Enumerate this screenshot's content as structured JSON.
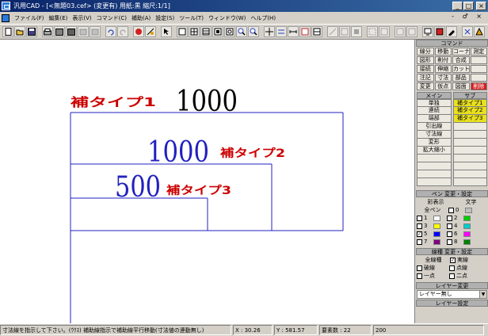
{
  "window": {
    "title": "汎用CAD - [<無題03.cef> (変更有) 用紙:黒 縮尺:1/1]",
    "controls": [
      "_",
      "□",
      "×"
    ],
    "mdi_controls": "- ♂ ×"
  },
  "menu": [
    "ファイル(F)",
    "編集(E)",
    "表示(V)",
    "コマンド(C)",
    "補助(A)",
    "設定(S)",
    "ツール(T)",
    "ウィンドウ(W)",
    "ヘルプ(H)"
  ],
  "toolbar": [
    "new",
    "open",
    "save",
    "print",
    "preview",
    "print2",
    "cut",
    "copy",
    "undo",
    "redo",
    "stop",
    "snap",
    "grid",
    "rect",
    "dim",
    "delete",
    "zoom-in",
    "zoom-out",
    "pan",
    "fit",
    "move",
    "line",
    "arc",
    "text",
    "layer",
    "ortho",
    "frame",
    "check",
    "help",
    "palette"
  ],
  "canvas": {
    "dims": [
      {
        "value": "1000",
        "label": "補タイプ1",
        "value_color": "#000000",
        "label_color": "#cc0000"
      },
      {
        "value": "1000",
        "label": "補タイプ2",
        "value_color": "#2020c0",
        "label_color": "#cc0000"
      },
      {
        "value": "500",
        "label": "補タイプ3",
        "value_color": "#2020c0",
        "label_color": "#cc0000"
      }
    ],
    "line_color": "#2020c0"
  },
  "panel": {
    "command_header": "コマンド",
    "commands": [
      "線分",
      "移動",
      "コーナー",
      "測定",
      "図形",
      "削付",
      "合成",
      "",
      "接続",
      "伸縮",
      "カット",
      "",
      "注記",
      "寸法",
      "部品",
      "",
      "変更",
      "仮点",
      "図面",
      "削除"
    ],
    "main_header": "メイン",
    "sub_header": "サブ",
    "main_items": [
      "単独",
      "連続",
      "端部",
      "引出線",
      "寸法線",
      "変形",
      "拡大縮小",
      "",
      "",
      "",
      ""
    ],
    "sub_items": [
      "補タイプ1",
      "補タイプ2",
      "補タイプ3",
      "",
      "",
      "",
      "",
      "",
      "",
      "",
      ""
    ],
    "pen_header": "ペン 変更・設定",
    "pen_subheader": [
      "彩表示",
      "文字"
    ],
    "all_pen": "全ペン",
    "pens": [
      {
        "left_num": "1",
        "left_color": "#ffffff",
        "right_num": "2",
        "right_color": "#00cc00"
      },
      {
        "left_num": "3",
        "left_color": "#ffff00",
        "right_num": "4",
        "right_color": "#00cccc"
      },
      {
        "left_num": "5",
        "left_color": "#0000ff",
        "right_num": "6",
        "right_color": "#ff00ff"
      },
      {
        "left_num": "7",
        "left_color": "#800080",
        "right_num": "8",
        "right_color": "#008000"
      }
    ],
    "pen_top_num": "0",
    "pen_top_color": "#c0c0c0",
    "line_header": "線種 変更・設定",
    "all_line": "全線種",
    "line_types": [
      "実線",
      "破線",
      "点線",
      "一点",
      "二点"
    ],
    "layer_header": "レイヤー変更",
    "layer_select": "レイヤー無し",
    "layer_setting": "レイヤー設定"
  },
  "status": {
    "message": "寸法線を指示して下さい。(ｳｸｽ) 補助線指示で補助線平行移動(寸法値の連動無し)",
    "x": "X : 30.26",
    "y": "Y : 581.57",
    "count": "要素数 : 22",
    "value": "200"
  }
}
